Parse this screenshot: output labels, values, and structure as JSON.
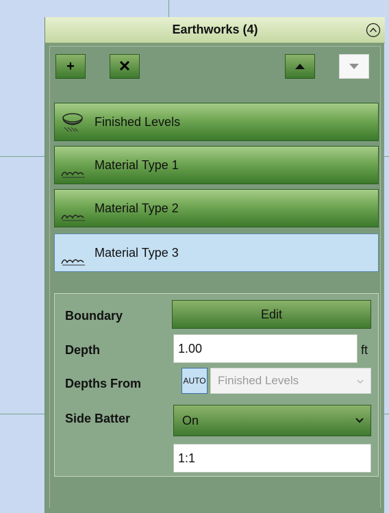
{
  "panel": {
    "title": "Earthworks (4)",
    "toolbar": {
      "add_label": "+",
      "delete_label": "✕"
    },
    "layers": [
      {
        "label": "Finished Levels",
        "icon": "finished-levels-icon",
        "selected": false
      },
      {
        "label": "Material Type 1",
        "icon": "material-icon",
        "selected": false
      },
      {
        "label": "Material Type 2",
        "icon": "material-icon",
        "selected": false
      },
      {
        "label": "Material Type 3",
        "icon": "material-icon",
        "selected": true
      }
    ],
    "properties": {
      "boundary_label": "Boundary",
      "boundary_button": "Edit",
      "depth_label": "Depth",
      "depth_value": "1.00",
      "depth_unit": "ft",
      "depths_from_label": "Depths From",
      "auto_label": "AUTO",
      "depths_from_value": "Finished Levels",
      "side_batter_label": "Side Batter",
      "side_batter_value": "On",
      "ratio_value": "1:1"
    }
  },
  "colors": {
    "accent_green": "#4f8a3c",
    "selected_blue": "#c5e0f3",
    "header": "#d9e7bb"
  }
}
